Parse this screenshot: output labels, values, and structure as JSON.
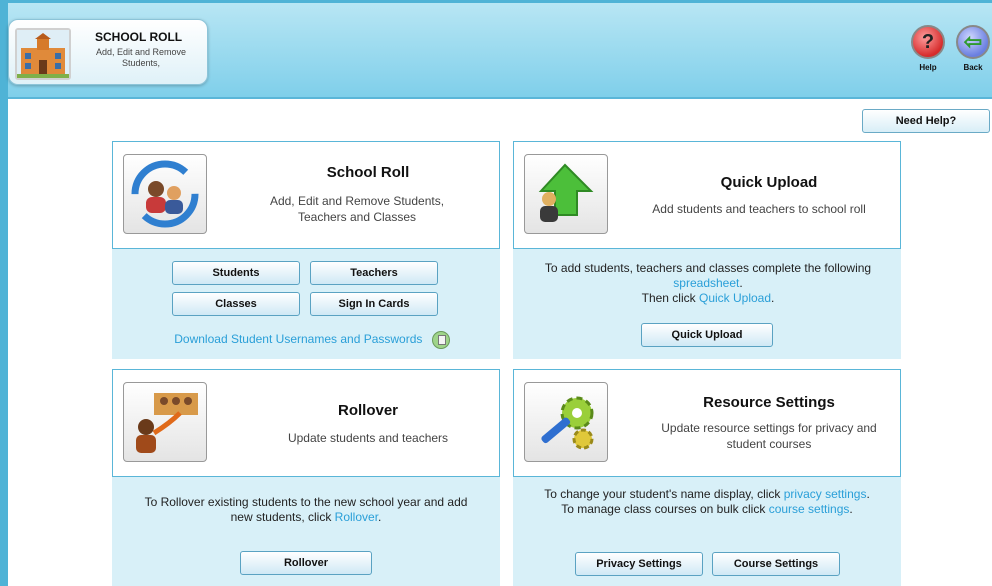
{
  "header": {
    "title": "SCHOOL ROLL",
    "subtitle": "Add, Edit and Remove Students,",
    "help_label": "Help",
    "back_label": "Back",
    "help_glyph": "?",
    "back_glyph": "⇦"
  },
  "need_help_label": "Need Help?",
  "school_roll": {
    "title": "School Roll",
    "description": "Add, Edit and Remove Students, Teachers and Classes",
    "buttons": [
      "Students",
      "Teachers",
      "Classes",
      "Sign In Cards"
    ],
    "download_link": "Download Student Usernames and Passwords"
  },
  "quick_upload": {
    "title": "Quick Upload",
    "description": "Add students and teachers to school roll",
    "text_before": "To add students, teachers and classes complete the following",
    "link_spreadsheet": "spreadsheet",
    "text_period": ".",
    "text_then": "Then click",
    "link_quick_upload": "Quick Upload",
    "button": "Quick Upload"
  },
  "rollover": {
    "title": "Rollover",
    "description": "Update students and teachers",
    "text_before": "To Rollover existing students to the new school year and add new students, click",
    "link": "Rollover",
    "button": "Rollover"
  },
  "resource_settings": {
    "title": "Resource Settings",
    "description": "Update resource settings for privacy and student courses",
    "line1_text": "To change your student's name display, click",
    "line1_link": "privacy settings",
    "line2_text": "To manage class courses on bulk click",
    "line2_link": "course settings",
    "buttons": [
      "Privacy Settings",
      "Course Settings"
    ]
  },
  "colors": {
    "accent": "#4fb3d6",
    "panel_bg": "#d8f0f8",
    "link": "#2a9fd8"
  }
}
